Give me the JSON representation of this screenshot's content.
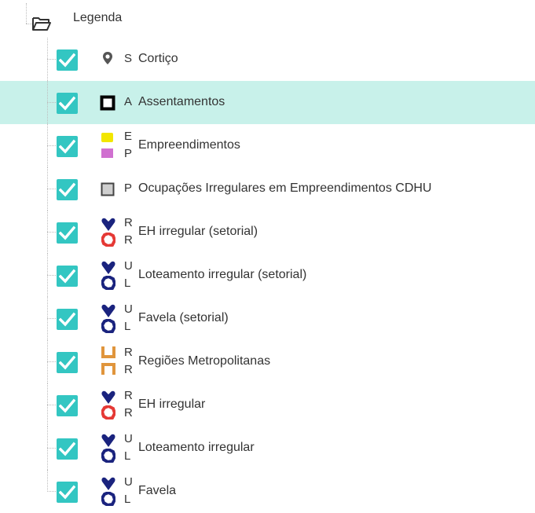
{
  "tree": {
    "root": {
      "label": "Legenda",
      "icon": "folder-open-icon"
    },
    "items": [
      {
        "label": "Cortiço",
        "checked": true,
        "symbol": "pin",
        "mini": [
          "S"
        ]
      },
      {
        "label": "Assentamentos",
        "checked": true,
        "symbol": "square-outline",
        "mini": [
          "A"
        ],
        "selected": true
      },
      {
        "label": "Empreendimentos",
        "checked": true,
        "symbol": "yellow-magenta",
        "mini": [
          "E",
          "P"
        ]
      },
      {
        "label": "Ocupações Irregulares em Empreendimentos CDHU",
        "checked": true,
        "symbol": "gray-square",
        "mini": [
          "P"
        ]
      },
      {
        "label": "EH irregular (setorial)",
        "checked": true,
        "symbol": "blue-red",
        "mini": [
          "R",
          "R"
        ]
      },
      {
        "label": "Loteamento irregular (setorial)",
        "checked": true,
        "symbol": "blue-blue",
        "mini": [
          "U",
          "L"
        ]
      },
      {
        "label": "Favela (setorial)",
        "checked": true,
        "symbol": "blue-blue",
        "mini": [
          "U",
          "L"
        ]
      },
      {
        "label": "Regiões Metropolitanas",
        "checked": true,
        "symbol": "orange-brackets",
        "mini": [
          "R",
          "R"
        ]
      },
      {
        "label": "EH irregular",
        "checked": true,
        "symbol": "blue-red",
        "mini": [
          "R",
          "R"
        ]
      },
      {
        "label": "Loteamento irregular",
        "checked": true,
        "symbol": "blue-blue",
        "mini": [
          "U",
          "L"
        ]
      },
      {
        "label": "Favela",
        "checked": true,
        "symbol": "blue-blue",
        "mini": [
          "U",
          "L"
        ]
      }
    ]
  },
  "colors": {
    "checkbox": "#33c6c2",
    "selected_row": "#c8f1ea",
    "symbol_blue": "#1a237e",
    "symbol_red": "#e53935",
    "symbol_orange": "#e0953c",
    "symbol_yellow": "#f2e600",
    "symbol_magenta": "#d070d0"
  }
}
